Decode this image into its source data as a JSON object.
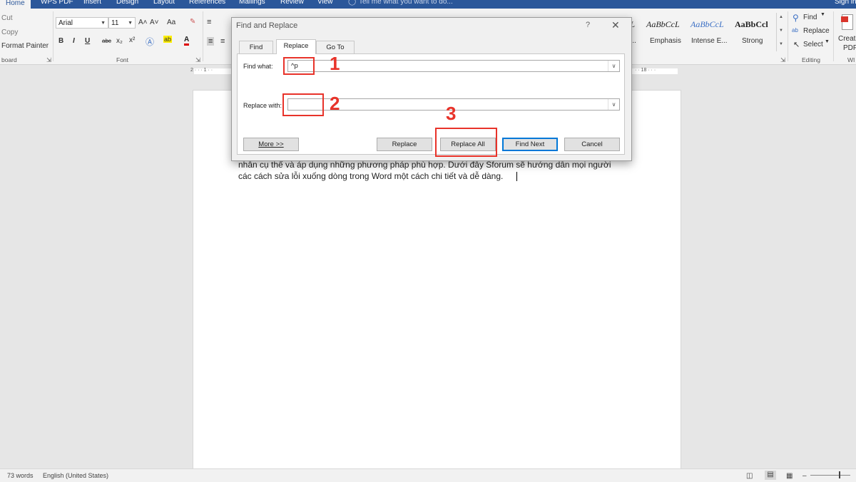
{
  "tabs": [
    "Home",
    "WPS PDF",
    "Insert",
    "Design",
    "Layout",
    "References",
    "Mailings",
    "Review",
    "View"
  ],
  "tell_me": "Tell me what you want to do...",
  "sign_in": "Sign in",
  "clipboard": {
    "cut": "Cut",
    "copy": "Copy",
    "format_painter": "Format Painter",
    "label": "board"
  },
  "font": {
    "name": "Arial",
    "size": "11",
    "label": "Font",
    "grow": "A˄",
    "shrink": "A˅",
    "case": "Aa",
    "bold": "B",
    "italic": "I",
    "underline": "U",
    "strike": "abc",
    "sub": "x₂",
    "sup": "x²"
  },
  "styles": [
    {
      "sample": "cL",
      "name": "n..."
    },
    {
      "sample": "AaBbCcL",
      "name": "Emphasis"
    },
    {
      "sample": "AaBbCcL",
      "name": "Intense E..."
    },
    {
      "sample": "AaBbCcl",
      "name": "Strong"
    }
  ],
  "editing": {
    "find": "Find",
    "replace": "Replace",
    "select": "Select",
    "label": "Editing"
  },
  "wps": {
    "create": "Creat",
    "pdf": "PDF",
    "label": "WI"
  },
  "ruler": {
    "left": "2 · · · 1 · ·",
    "right": "· · 18 · · ·"
  },
  "document": {
    "line1": "nhân cụ thể và áp dụng những phương pháp phù hợp. Dưới đây Sforum sẽ hướng dẫn mọi người",
    "line2": "các cách sửa lỗi xuống dòng trong Word một cách chi tiết và dễ dàng."
  },
  "dialog": {
    "title": "Find and Replace",
    "help": "?",
    "close": "✕",
    "tabs": [
      "Find",
      "Replace",
      "Go To"
    ],
    "find_label": "Find what:",
    "find_value": "^p",
    "replace_label": "Replace with:",
    "replace_value": "",
    "buttons": {
      "more": "More >>",
      "replace": "Replace",
      "replace_all": "Replace All",
      "find_next": "Find Next",
      "cancel": "Cancel"
    }
  },
  "annotations": [
    "1",
    "2",
    "3"
  ],
  "annotation_color": "#e8332a",
  "status": {
    "words": "73 words",
    "language": "English (United States)"
  }
}
